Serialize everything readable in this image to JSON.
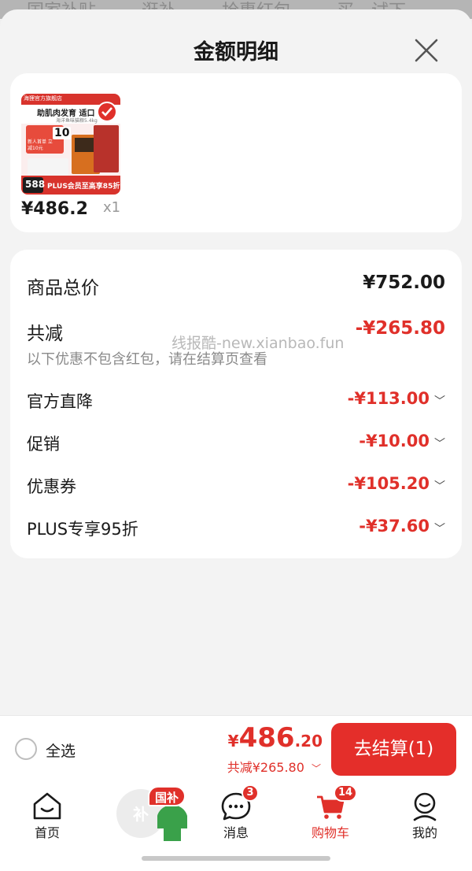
{
  "background_tabs": [
    "国家补贴",
    "逛补",
    "抢惠红包",
    "买",
    "试下"
  ],
  "sheet": {
    "title": "金额明细",
    "close_icon": "close-icon"
  },
  "product": {
    "price": "¥486.2",
    "quantity": "x1",
    "thumb": {
      "shop": "海狸官方旗舰店",
      "headline": "助肌肉发育 适口",
      "sub": "海洋鱼味猫粮5.4kg",
      "promo_price": "588",
      "promo_text": "PLUS会员至高享85折",
      "coupon_value": "10",
      "coupon_text": "新人首单 立减10元"
    }
  },
  "details": {
    "total_label": "商品总价",
    "total_value": "¥752.00",
    "reduce_label": "共减",
    "reduce_value": "-¥265.80",
    "note": "以下优惠不包含红包，请在结算页查看",
    "items": [
      {
        "label": "官方直降",
        "value": "-¥113.00"
      },
      {
        "label": "促销",
        "value": "-¥10.00"
      },
      {
        "label": "优惠券",
        "value": "-¥105.20"
      },
      {
        "label": "PLUS专享95折",
        "value": "-¥37.60"
      }
    ]
  },
  "watermark": "线报酷-new.xianbao.fun",
  "checkout": {
    "select_all": "全选",
    "price_yen": "¥",
    "price_int": "486",
    "price_dec": ".20",
    "discount": "共减¥265.80",
    "button": "去结算(1)"
  },
  "tabbar": {
    "items": [
      {
        "label": "首页",
        "icon": "home-icon"
      },
      {
        "label": "",
        "icon": "subsidy-icon",
        "badge": "国补",
        "glyph": "补"
      },
      {
        "label": "消息",
        "icon": "message-icon",
        "badge": "3"
      },
      {
        "label": "购物车",
        "icon": "cart-icon",
        "badge": "14"
      },
      {
        "label": "我的",
        "icon": "profile-icon"
      }
    ]
  },
  "colors": {
    "accent_red": "#e0302a",
    "button_red": "#e42e2a",
    "subsidy_green": "#3aa14a"
  }
}
